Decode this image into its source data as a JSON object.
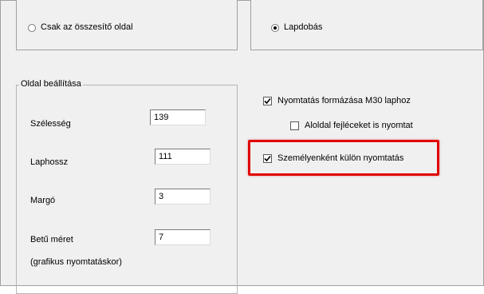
{
  "top_left_option": {
    "label": "Csak az összesítő oldal",
    "checked": false
  },
  "top_right_option": {
    "label": "Lapdobás",
    "checked": true
  },
  "page_settings": {
    "title": "Oldal beállítása",
    "fields": [
      {
        "label": "Szélesség",
        "value": "139"
      },
      {
        "label": "Laphossz",
        "value": "111"
      },
      {
        "label": "Margó",
        "value": "3"
      },
      {
        "label": "Betű méret",
        "value": "7"
      }
    ],
    "note": "(grafikus nyomtatáskor)"
  },
  "options": [
    {
      "label": "Nyomtatás formázása M30 laphoz",
      "checked": true
    },
    {
      "label": "Aloldal fejléceket is nyomtat",
      "checked": false
    },
    {
      "label": "Személyenként külön nyomtatás",
      "checked": true
    }
  ],
  "colors": {
    "highlight": "#e00000",
    "background": "#f0f0f0"
  }
}
